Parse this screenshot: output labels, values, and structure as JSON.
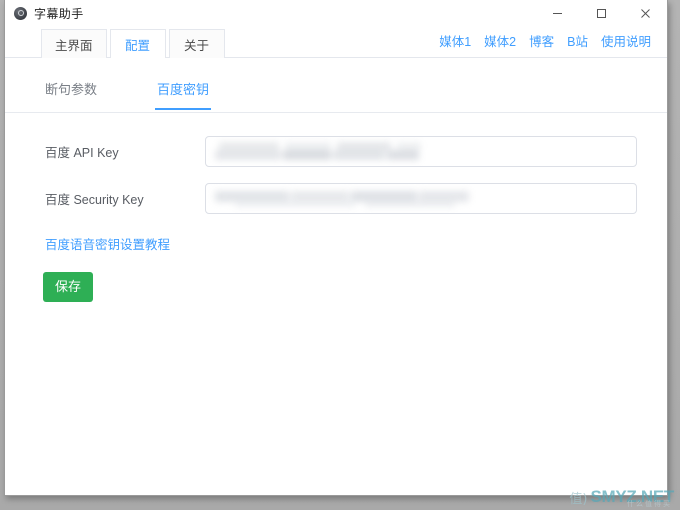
{
  "window": {
    "title": "字幕助手",
    "icon": "app-circle-icon",
    "controls": {
      "minimize": "minimize-icon",
      "maximize": "maximize-icon",
      "close": "close-icon"
    }
  },
  "tabs": [
    {
      "label": "主界面",
      "active": false
    },
    {
      "label": "配置",
      "active": true
    },
    {
      "label": "关于",
      "active": false
    }
  ],
  "header_links": [
    {
      "label": "媒体1"
    },
    {
      "label": "媒体2"
    },
    {
      "label": "博客"
    },
    {
      "label": "B站"
    },
    {
      "label": "使用说明"
    }
  ],
  "subtabs": [
    {
      "label": "断句参数",
      "active": false
    },
    {
      "label": "百度密钥",
      "active": true
    }
  ],
  "form": {
    "fields": [
      {
        "label": "百度 API Key",
        "value": "",
        "placeholder": "",
        "redacted": true
      },
      {
        "label": "百度 Security Key",
        "value": "",
        "placeholder": "",
        "redacted": true
      }
    ],
    "tutorial_link": "百度语音密钥设置教程",
    "save_label": "保存"
  },
  "colors": {
    "accent_blue": "#409eff",
    "save_green": "#2eaf55",
    "border_gray": "#dcdfe6",
    "text_gray": "#585c63",
    "watermark_teal": "#57a8b8"
  },
  "watermark": {
    "badge": "值)",
    "text": "SMYZ.NET",
    "sub": "什么值得买"
  }
}
